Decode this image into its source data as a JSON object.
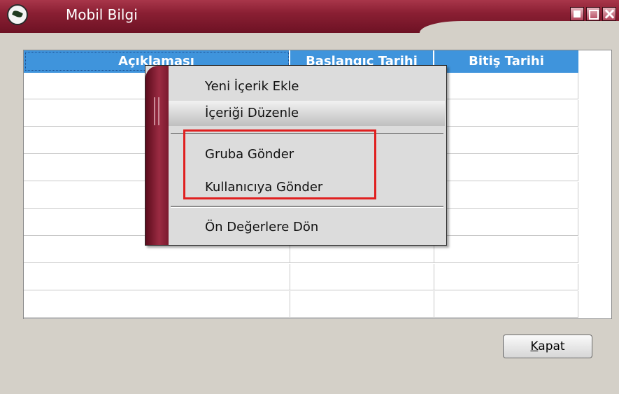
{
  "window": {
    "title": "Mobil Bilgi"
  },
  "grid": {
    "columns": [
      "Açıklaması",
      "Başlangıç Tarihi",
      "Bitiş Tarihi"
    ],
    "row_count": 9
  },
  "footer": {
    "close_label_prefix": "K",
    "close_label_rest": "apat"
  },
  "context_menu": {
    "items": [
      {
        "label": "Yeni İçerik Ekle"
      },
      {
        "label": "İçeriği Düzenle"
      },
      {
        "label": "Gruba Gönder"
      },
      {
        "label": "Kullanıcıya Gönder"
      },
      {
        "label": "Ön Değerlere Dön"
      }
    ]
  },
  "colors": {
    "titlebar": "#8a1f33",
    "header": "#3f94dc",
    "annotation": "#e02020"
  }
}
